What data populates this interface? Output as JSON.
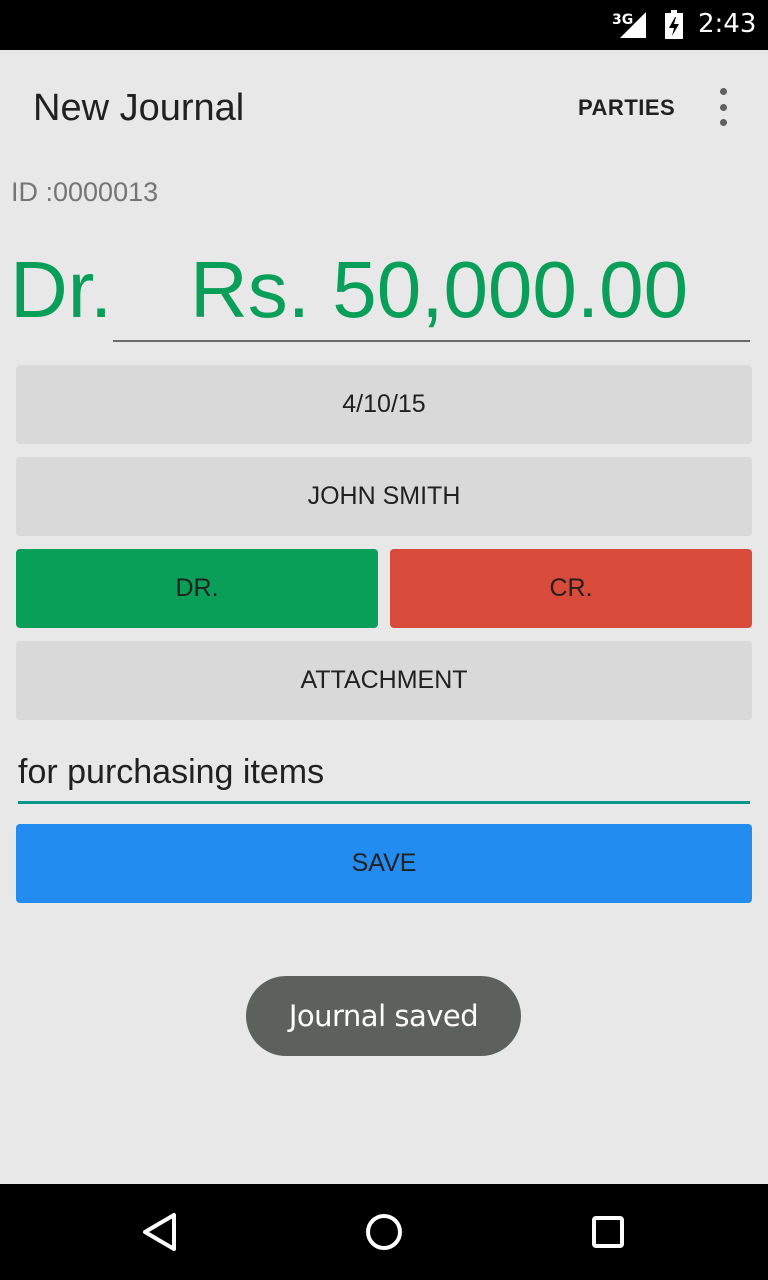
{
  "status_bar": {
    "network": "3G",
    "time": "2:43",
    "signal_icon": "signal-icon",
    "battery_icon": "battery-charging-icon"
  },
  "app_bar": {
    "title": "New Journal",
    "action": "PARTIES",
    "overflow_icon": "more-vert-icon"
  },
  "journal": {
    "id_text": "ID :0000013",
    "side_label": "Dr.",
    "amount": "Rs. 50,000.00"
  },
  "buttons": {
    "date": "4/10/15",
    "party": "JOHN SMITH",
    "dr": "DR.",
    "cr": "CR.",
    "attachment": "ATTACHMENT",
    "save": "SAVE"
  },
  "note": {
    "value": "for purchasing items"
  },
  "toast": {
    "message": "Journal saved"
  },
  "nav_bar": {
    "back_icon": "back-triangle-icon",
    "home_icon": "home-circle-icon",
    "recents_icon": "recents-square-icon"
  },
  "colors": {
    "accent_green": "#0a9f58",
    "credit_red": "#d84a3a",
    "save_blue": "#228cf1",
    "field_teal": "#0b948a"
  }
}
